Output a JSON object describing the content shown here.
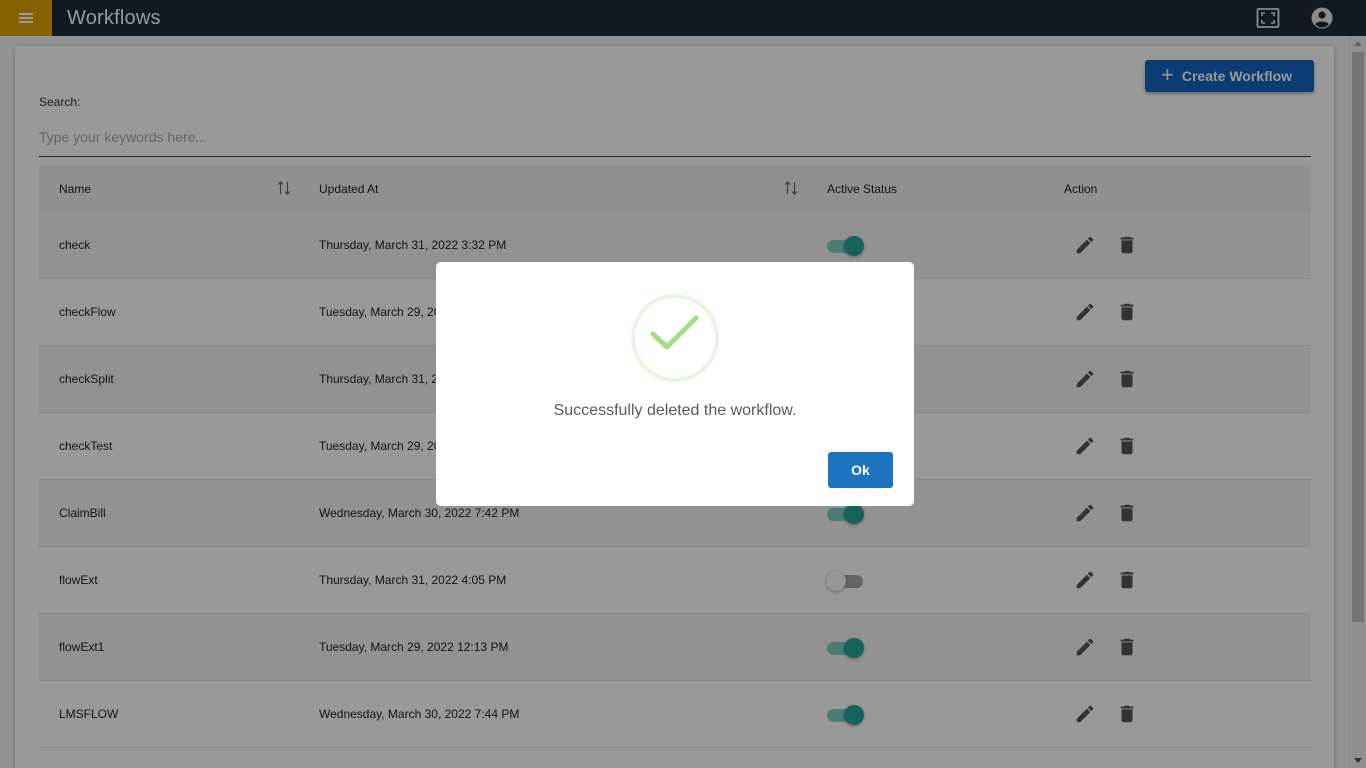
{
  "header": {
    "title": "Workflows",
    "menu_icon": "hamburger-menu-icon",
    "fullscreen_icon": "fullscreen-icon",
    "account_icon": "account-circle-icon"
  },
  "toolbar": {
    "create_label": "Create Workflow"
  },
  "search": {
    "label": "Search:",
    "placeholder": "Type your keywords here...",
    "value": ""
  },
  "table": {
    "columns": [
      "Name",
      "Updated At",
      "Active Status",
      "Action"
    ],
    "rows": [
      {
        "name": "check",
        "updated_at": "Thursday, March 31, 2022 3:32 PM",
        "active": true
      },
      {
        "name": "checkFlow",
        "updated_at": "Tuesday, March 29, 20",
        "active": true
      },
      {
        "name": "checkSplit",
        "updated_at": "Thursday, March 31, 2",
        "active": true
      },
      {
        "name": "checkTest",
        "updated_at": "Tuesday, March 29, 20",
        "active": true
      },
      {
        "name": "ClaimBill",
        "updated_at": "Wednesday, March 30, 2022 7:42 PM",
        "active": true
      },
      {
        "name": "flowExt",
        "updated_at": "Thursday, March 31, 2022 4:05 PM",
        "active": false
      },
      {
        "name": "flowExt1",
        "updated_at": "Tuesday, March 29, 2022 12:13 PM",
        "active": true
      },
      {
        "name": "LMSFLOW",
        "updated_at": "Wednesday, March 30, 2022 7:44 PM",
        "active": true
      }
    ]
  },
  "dialog": {
    "message": "Successfully deleted the workflow.",
    "ok_label": "Ok",
    "icon": "success-check-icon"
  },
  "colors": {
    "topbar": "#212b36",
    "menu_accent": "#e0a400",
    "primary_button": "#1565c0",
    "toggle_on": "#26a69a",
    "success_green": "#a5dc86"
  }
}
